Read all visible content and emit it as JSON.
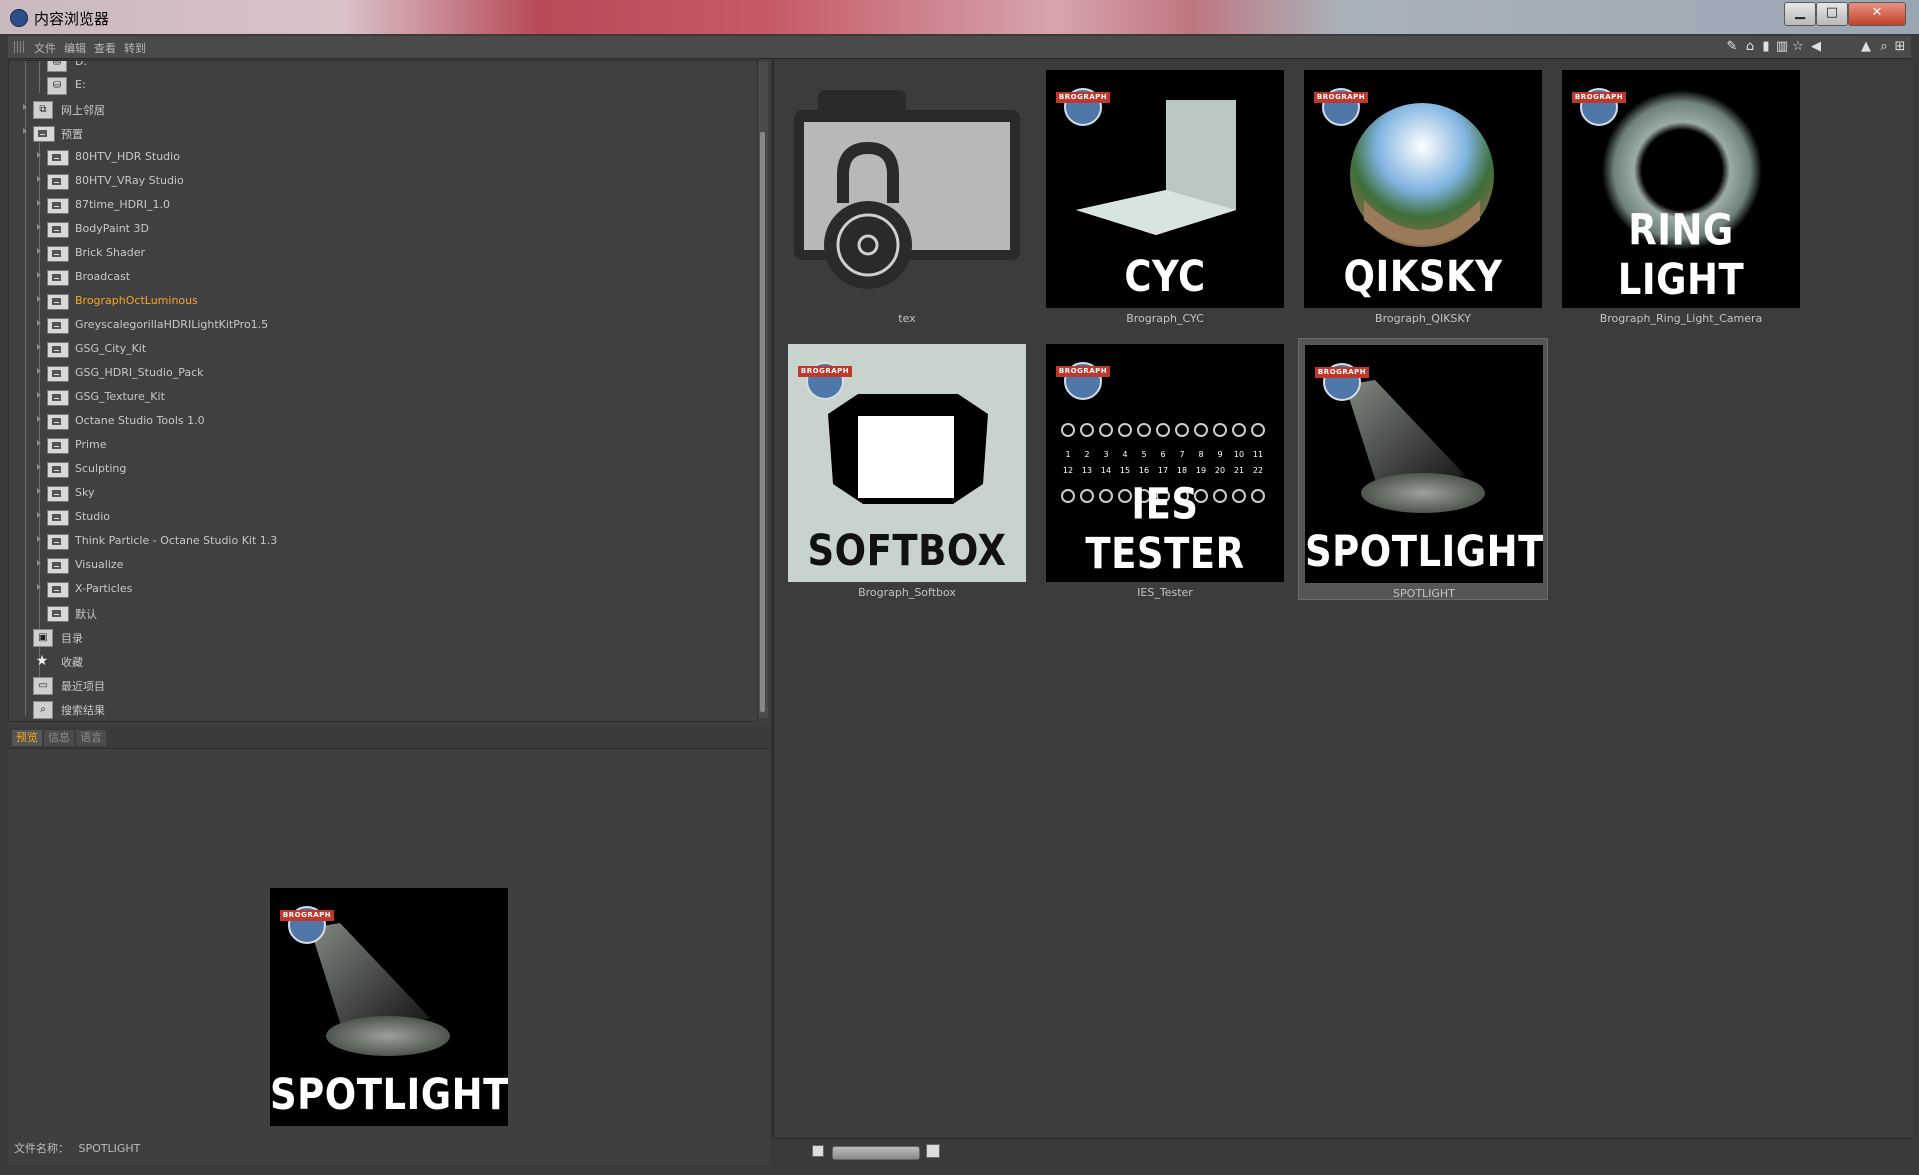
{
  "window": {
    "title": "内容浏览器"
  },
  "menu": {
    "items": [
      "文件",
      "编辑",
      "查看",
      "转到"
    ]
  },
  "tree": {
    "partial_top": "D:",
    "items": [
      {
        "label": "E:",
        "kind": "drive"
      },
      {
        "label": "网上邻居",
        "kind": "network"
      },
      {
        "label": "预置",
        "kind": "folder-root"
      },
      {
        "label": "80HTV_HDR Studio",
        "kind": "lib"
      },
      {
        "label": "80HTV_VRay Studio",
        "kind": "lib"
      },
      {
        "label": "87time_HDRI_1.0",
        "kind": "lib"
      },
      {
        "label": "BodyPaint 3D",
        "kind": "lib"
      },
      {
        "label": "Brick Shader",
        "kind": "lib"
      },
      {
        "label": "Broadcast",
        "kind": "lib"
      },
      {
        "label": "BrographOctLuminous",
        "kind": "lib",
        "selected": true
      },
      {
        "label": "GreyscalegorillaHDRILightKitPro1.5",
        "kind": "lib"
      },
      {
        "label": "GSG_City_Kit",
        "kind": "lib"
      },
      {
        "label": "GSG_HDRI_Studio_Pack",
        "kind": "lib"
      },
      {
        "label": "GSG_Texture_Kit",
        "kind": "lib"
      },
      {
        "label": "Octane Studio Tools 1.0",
        "kind": "lib"
      },
      {
        "label": "Prime",
        "kind": "lib"
      },
      {
        "label": "Sculpting",
        "kind": "lib"
      },
      {
        "label": "Sky",
        "kind": "lib"
      },
      {
        "label": "Studio",
        "kind": "lib"
      },
      {
        "label": "Think Particle - Octane Studio Kit 1.3",
        "kind": "lib"
      },
      {
        "label": "Visualize",
        "kind": "lib"
      },
      {
        "label": "X-Particles",
        "kind": "lib"
      },
      {
        "label": "默认",
        "kind": "folder"
      },
      {
        "label": "目录",
        "kind": "catalog"
      },
      {
        "label": "收藏",
        "kind": "favorites"
      },
      {
        "label": "最近项目",
        "kind": "recent"
      },
      {
        "label": "搜索结果",
        "kind": "search"
      }
    ]
  },
  "preview_tabs": [
    "预览",
    "信息",
    "语言"
  ],
  "preview": {
    "title": "SPOTLIGHT",
    "badge": "BROGRAPH"
  },
  "filename": {
    "label": "文件名称：",
    "value": "SPOTLIGHT"
  },
  "grid": [
    {
      "caption": "tex",
      "title": "",
      "kind": "locked-folder"
    },
    {
      "caption": "Brograph_CYC",
      "title": "CYC",
      "kind": "cyc"
    },
    {
      "caption": "Brograph_QIKSKY",
      "title": "QIKSKY",
      "kind": "qiksky"
    },
    {
      "caption": "Brograph_Ring_Light_Camera",
      "title": "RING LIGHT",
      "kind": "ring"
    },
    {
      "caption": "Brograph_Softbox",
      "title": "SOFTBOX",
      "kind": "softbox"
    },
    {
      "caption": "IES_Tester",
      "title": "IES TESTER",
      "kind": "ies"
    },
    {
      "caption": "SPOTLIGHT",
      "title": "SPOTLIGHT",
      "kind": "spot",
      "selected": true
    }
  ],
  "ies_numbers_row1": [
    "1",
    "2",
    "3",
    "4",
    "5",
    "6",
    "7",
    "8",
    "9",
    "10",
    "11"
  ],
  "ies_numbers_row2": [
    "12",
    "13",
    "14",
    "15",
    "16",
    "17",
    "18",
    "19",
    "20",
    "21",
    "22"
  ],
  "badge_text": "BROGRAPH",
  "colors": {
    "selected_text": "#f6a623",
    "panel_bg": "#3c3c3c"
  }
}
